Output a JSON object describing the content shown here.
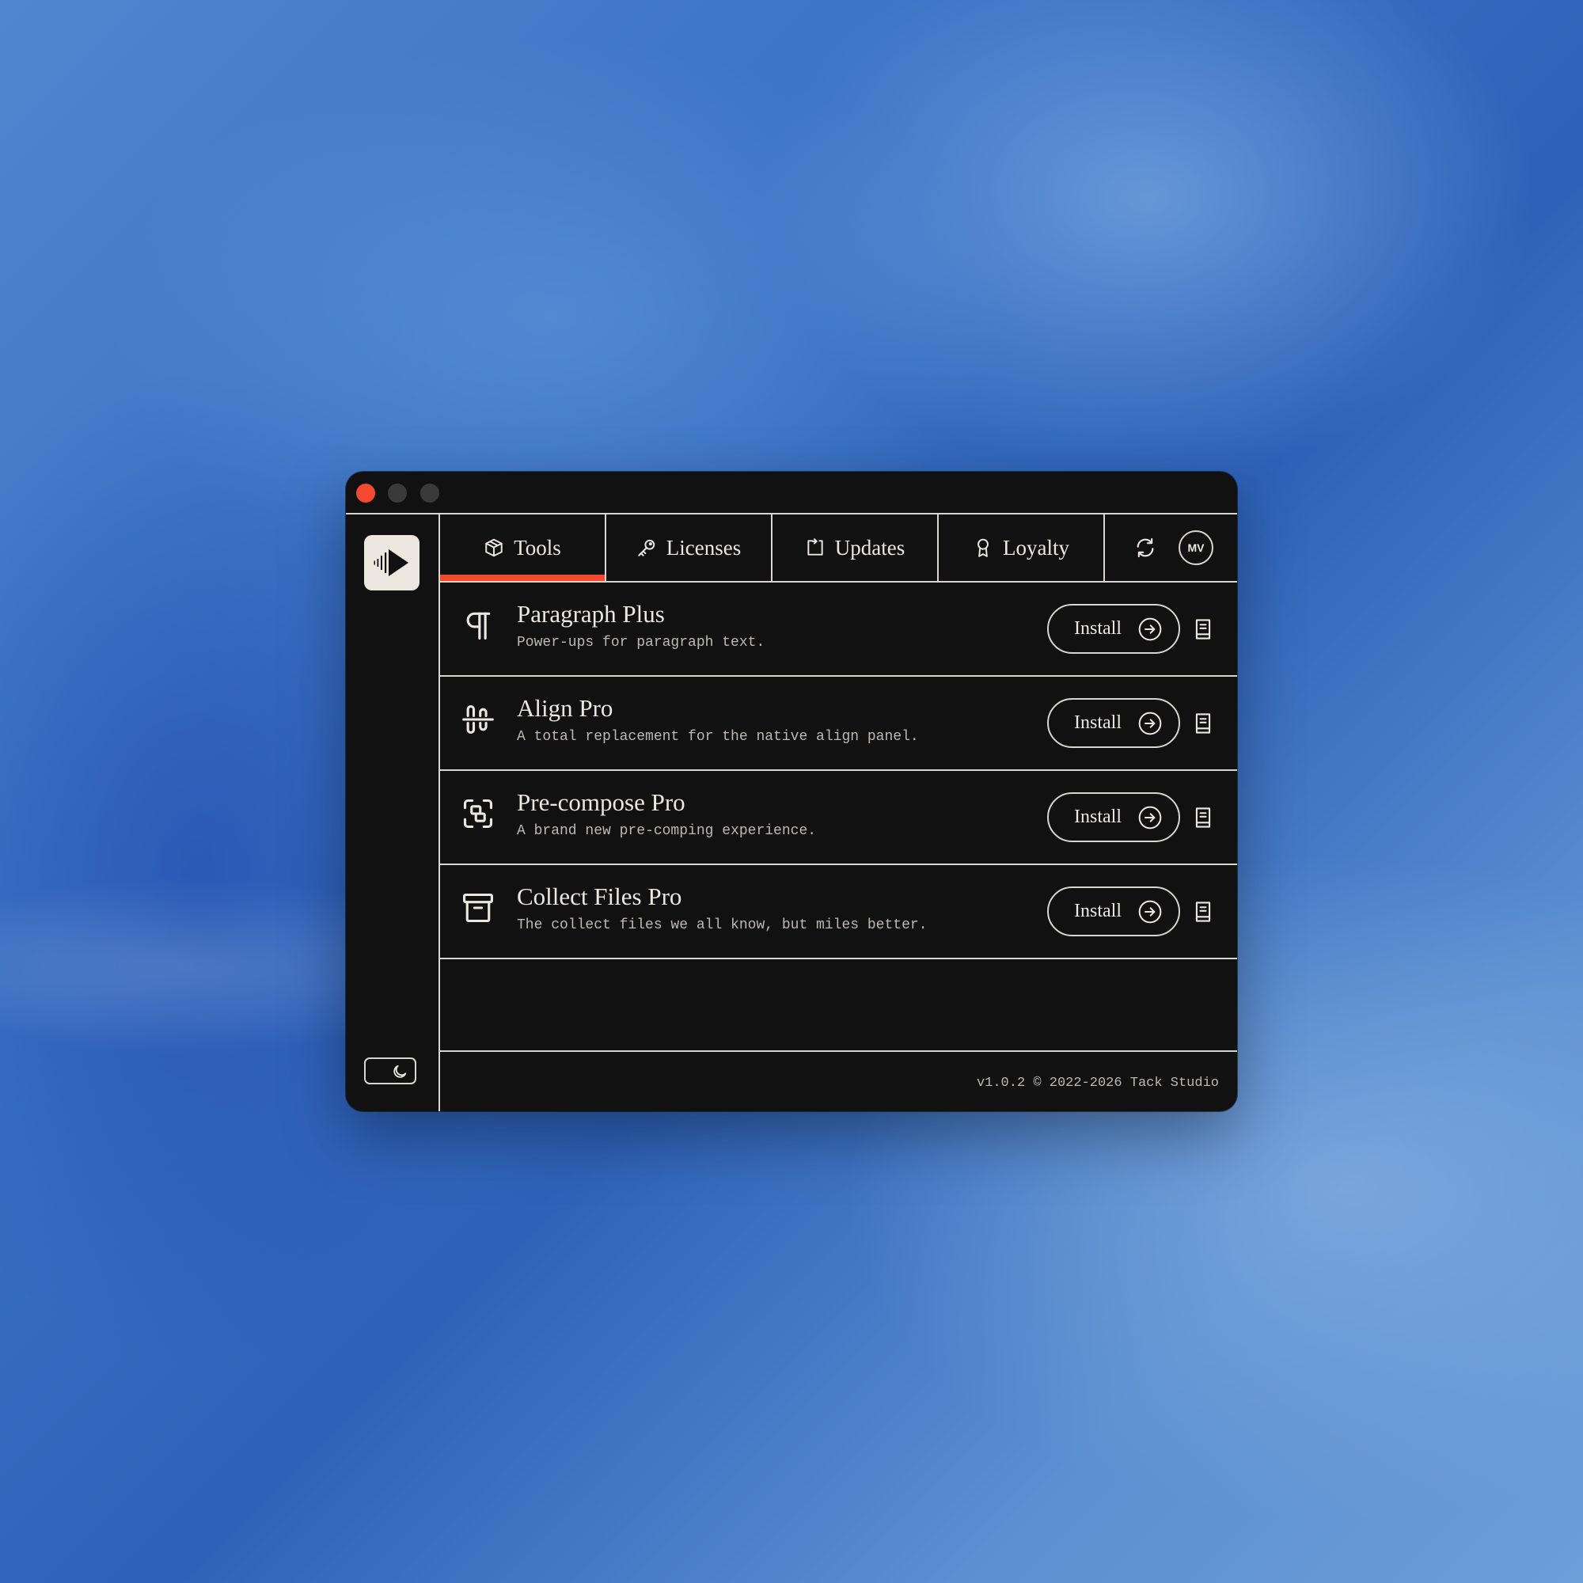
{
  "window": {
    "controls": [
      "close",
      "minimize",
      "maximize"
    ],
    "colors": {
      "background": "#121112",
      "accent": "#f2492f",
      "line": "#d9d6cf",
      "text": "#ece8df"
    }
  },
  "sidebar": {
    "logo_icon": "play-wave-logo",
    "theme_toggle_icon": "moon-icon"
  },
  "tabs": [
    {
      "label": "Tools",
      "icon": "cube-icon",
      "active": true
    },
    {
      "label": "Licenses",
      "icon": "key-icon",
      "active": false
    },
    {
      "label": "Updates",
      "icon": "update-icon",
      "active": false
    },
    {
      "label": "Loyalty",
      "icon": "award-icon",
      "active": false
    }
  ],
  "header": {
    "refresh_icon": "refresh-icon",
    "avatar_initials": "MV"
  },
  "tools": [
    {
      "title": "Paragraph Plus",
      "description": "Power-ups for paragraph text.",
      "icon": "pilcrow-icon",
      "action": "Install"
    },
    {
      "title": "Align Pro",
      "description": "A total replacement for the native align panel.",
      "icon": "align-icon",
      "action": "Install"
    },
    {
      "title": "Pre-compose Pro",
      "description": "A brand new pre-comping experience.",
      "icon": "precompose-icon",
      "action": "Install"
    },
    {
      "title": "Collect Files Pro",
      "description": "The collect files we all know, but miles better.",
      "icon": "archive-icon",
      "action": "Install"
    }
  ],
  "footer": {
    "text": "v1.0.2 © 2022-2026 Tack Studio"
  }
}
